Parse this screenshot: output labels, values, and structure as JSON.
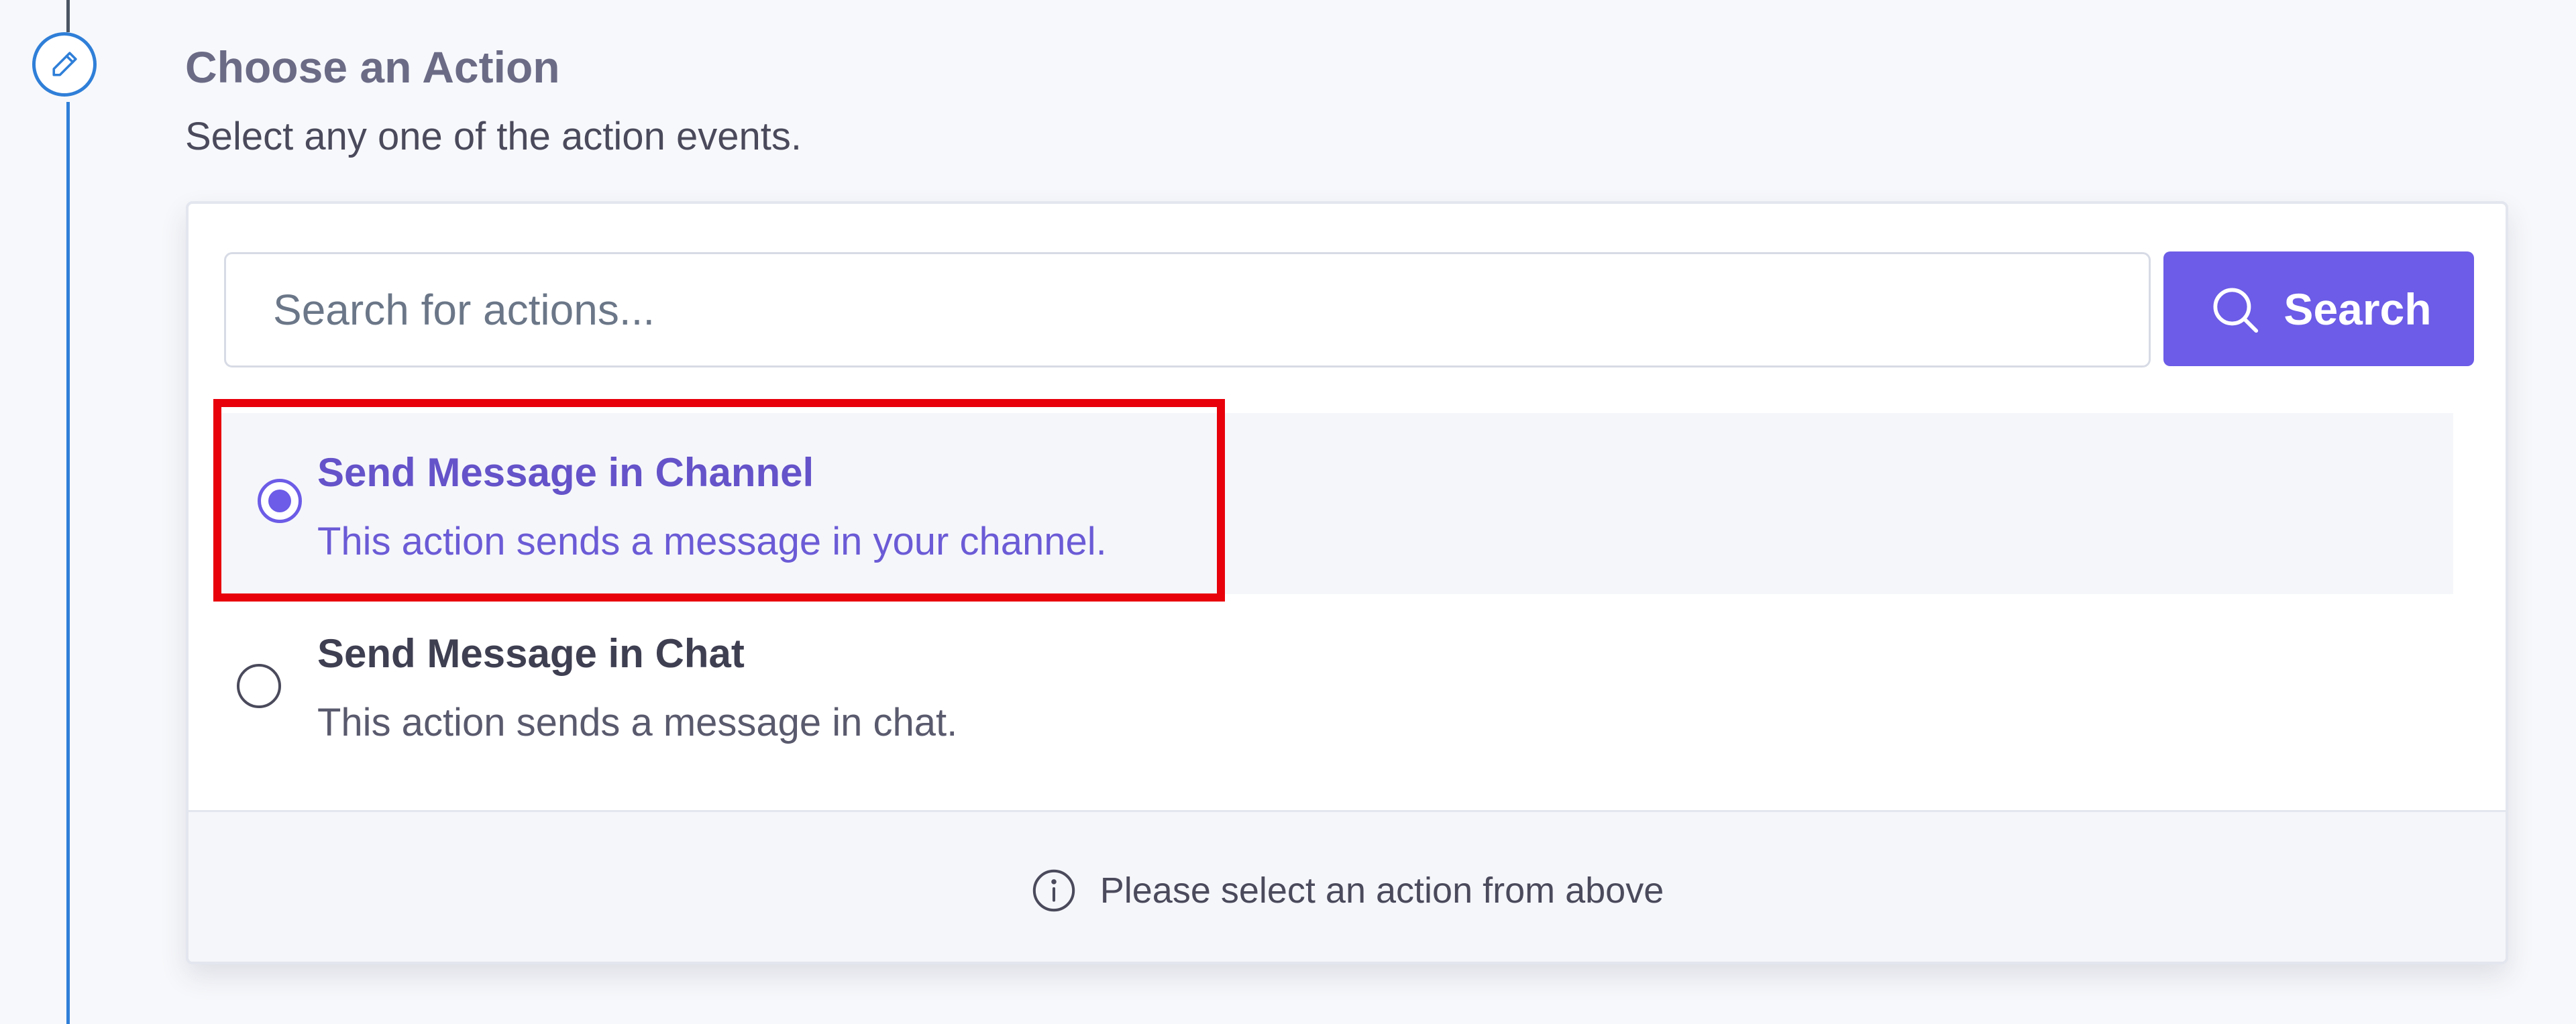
{
  "step": {
    "icon": "pencil-icon",
    "title": "Choose an Action",
    "subtitle": "Select any one of the action events."
  },
  "search": {
    "placeholder": "Search for actions...",
    "value": "",
    "button_label": "Search",
    "button_icon": "search-icon"
  },
  "actions": [
    {
      "title": "Send Message in Channel",
      "description": "This action sends a message in your channel.",
      "selected": true
    },
    {
      "title": "Send Message in Chat",
      "description": "This action sends a message in chat.",
      "selected": false
    }
  ],
  "footer": {
    "icon": "info-icon",
    "message": "Please select an action from above"
  },
  "colors": {
    "accent": "#6c5ce7",
    "timeline": "#2f7fd8",
    "highlight": "#e8000b",
    "selected_text": "#6453c9"
  }
}
